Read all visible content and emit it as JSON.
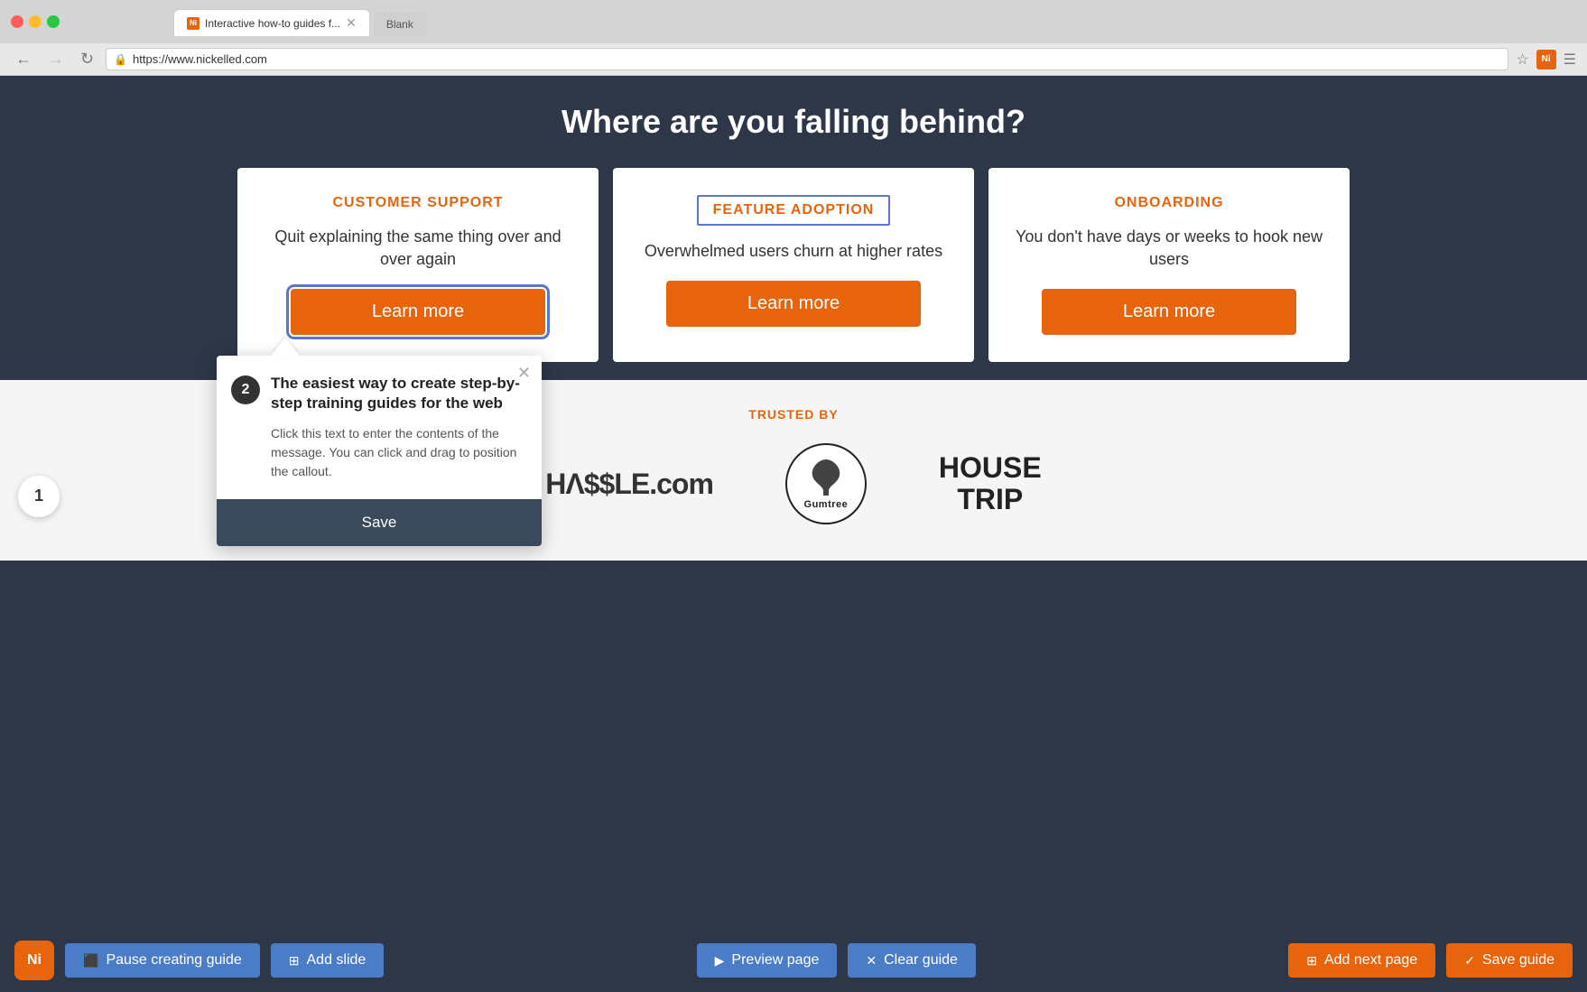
{
  "browser": {
    "tab_title": "Interactive how-to guides f...",
    "blank_tab": "Blank",
    "url": "https://www.nickelled.com",
    "favicon_label": "Ni"
  },
  "page": {
    "heading": "Where are you falling behind?",
    "cards": [
      {
        "id": "customer-support",
        "label": "CUSTOMER SUPPORT",
        "description": "Quit explaining the same thing over and over again",
        "btn_label": "Learn more",
        "highlighted": true
      },
      {
        "id": "feature-adoption",
        "label": "FEATURE ADOPTION",
        "description": "Overwhelmed users churn at higher rates",
        "btn_label": "Learn more",
        "highlighted": false
      },
      {
        "id": "onboarding",
        "label": "ONBOARDING",
        "description": "You don't have days or weeks to hook new users",
        "btn_label": "Learn more",
        "highlighted": false
      }
    ],
    "callout": {
      "step": "2",
      "title": "The easiest way to create step-by-step training guides for the web",
      "body": "Click this text to enter the contents of the message. You can click and drag to position the callout.",
      "save_label": "Save"
    },
    "trusted_by_label": "TRUSTED BY",
    "logos": [
      {
        "id": "hassle",
        "text": "HASSLE.com"
      },
      {
        "id": "gumtree",
        "text": "Gumtree"
      },
      {
        "id": "housetrip",
        "text": "HOUSE TRIP"
      }
    ]
  },
  "toolbar": {
    "ni_label": "Ni",
    "pause_label": "Pause creating guide",
    "add_slide_label": "Add slide",
    "preview_label": "Preview page",
    "clear_label": "Clear guide",
    "add_next_label": "Add next page",
    "save_label": "Save guide"
  },
  "step_circle": "1"
}
